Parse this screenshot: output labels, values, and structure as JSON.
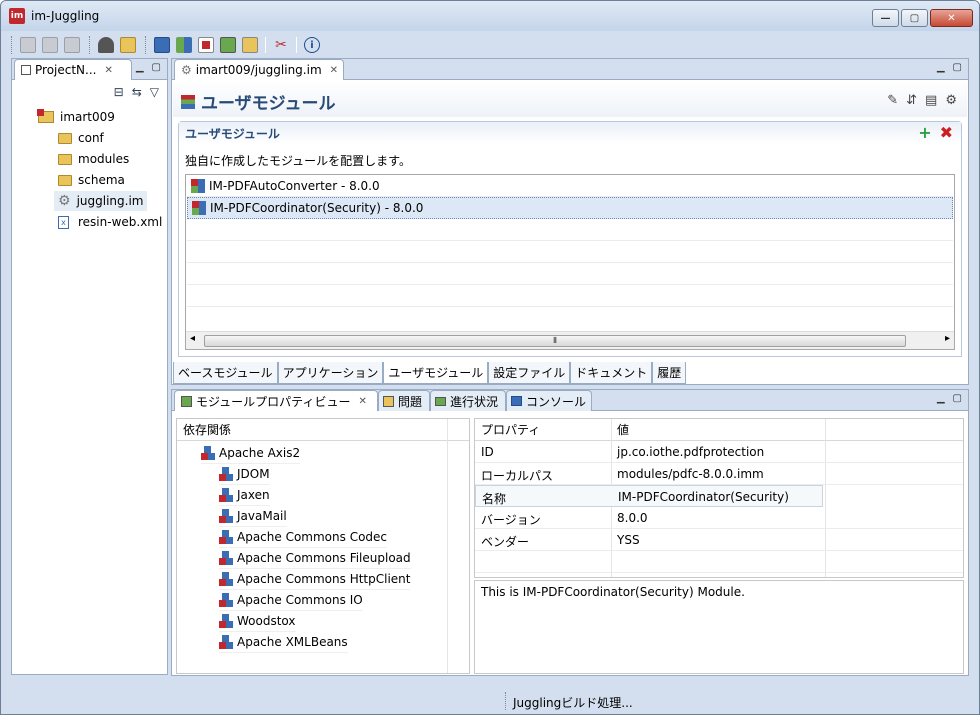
{
  "window": {
    "title": "im-Juggling",
    "controls": {
      "minimize": "—",
      "maximize": "▢",
      "close": "✕"
    }
  },
  "toolbar": {
    "icons": [
      "save-icon",
      "save-as-icon",
      "save-all-icon",
      "juggling-icon",
      "open-folder-icon",
      "monitor-icon",
      "export-icon",
      "module-icon",
      "image-icon",
      "tree-icon",
      "settings-tools-icon",
      "info-icon"
    ]
  },
  "project_navigator": {
    "tab_label": "ProjectN...",
    "tree": {
      "root": "imart009",
      "children": [
        "conf",
        "modules",
        "schema",
        "juggling.im",
        "resin-web.xml"
      ]
    }
  },
  "editor": {
    "tab_label": "imart009/juggling.im",
    "title": "ユーザモジュール",
    "section_title": "ユーザモジュール",
    "description": "独自に作成したモジュールを配置します。",
    "modules": [
      "IM-PDFAutoConverter - 8.0.0",
      "IM-PDFCoordinator(Security)  - 8.0.0"
    ],
    "selected_index": 1,
    "scroll_left": "◂",
    "scroll_right": "▸",
    "scroll_thumb": "⦀",
    "bottom_tabs": [
      "ベースモジュール",
      "アプリケーション",
      "ユーザモジュール",
      "設定ファイル",
      "ドキュメント",
      "履歴"
    ],
    "active_bottom_tab": 2
  },
  "properties_panel": {
    "tabs": [
      "モジュールプロパティビュー",
      "問題",
      "進行状況",
      "コンソール"
    ],
    "dependencies_header": "依存関係",
    "dependency_root": "Apache Axis2",
    "dependencies": [
      "JDOM",
      "Jaxen",
      "JavaMail",
      "Apache Commons Codec",
      "Apache Commons Fileupload",
      "Apache Commons HttpClient",
      "Apache Commons IO",
      "Woodstox",
      "Apache XMLBeans"
    ],
    "property_header": "プロパティ",
    "value_header": "値",
    "properties": [
      {
        "name": "ID",
        "value": "jp.co.iothe.pdfprotection"
      },
      {
        "name": "ローカルパス",
        "value": "modules/pdfc-8.0.0.imm"
      },
      {
        "name": "名称",
        "value": "IM-PDFCoordinator(Security)"
      },
      {
        "name": "バージョン",
        "value": "8.0.0"
      },
      {
        "name": "ベンダー",
        "value": "YSS"
      }
    ],
    "description": "This is IM-PDFCoordinator(Security)  Module."
  },
  "status": {
    "text": "Jugglingビルド処理..."
  },
  "colors": {
    "chrome": "#d3dfee",
    "editor_title": "#284a78",
    "selection": "#dde8f6",
    "add": "#2ea043",
    "remove": "#cc2020"
  }
}
